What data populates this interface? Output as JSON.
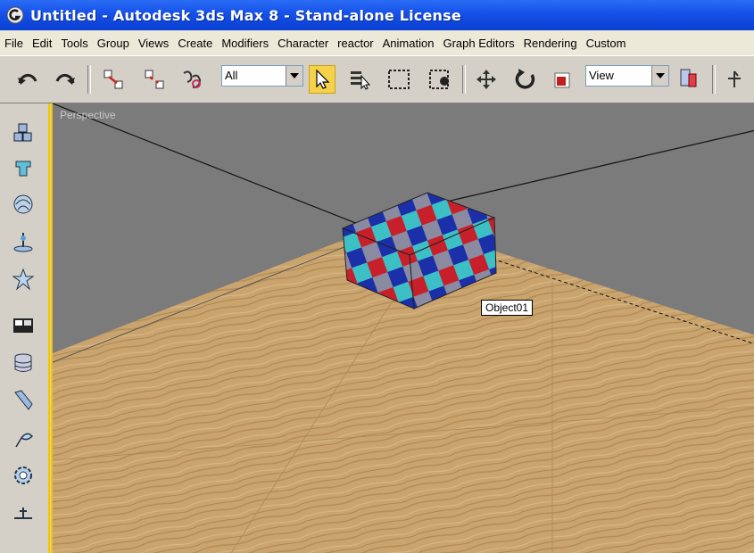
{
  "window": {
    "title": "Untitled - Autodesk 3ds Max 8  - Stand-alone License"
  },
  "menubar": {
    "items": [
      "File",
      "Edit",
      "Tools",
      "Group",
      "Views",
      "Create",
      "Modifiers",
      "Character",
      "reactor",
      "Animation",
      "Graph Editors",
      "Rendering",
      "Custom"
    ]
  },
  "toolbar": {
    "selection_filter": "All",
    "reference_coord": "View",
    "icons": [
      "undo-icon",
      "redo-icon",
      "select-and-link-icon",
      "unlink-selection-icon",
      "bind-to-space-warp-icon",
      "select-object-icon",
      "select-by-name-icon",
      "rectangular-selection-region-icon",
      "window-crossing-icon",
      "select-and-move-icon",
      "select-and-rotate-icon",
      "select-and-scale-icon",
      "use-pivot-center-icon",
      "select-and-manipulate-icon"
    ]
  },
  "command_panel": {
    "icons": [
      "create-icon",
      "modify-icon",
      "hierarchy-icon",
      "motion-icon",
      "display-icon",
      "utilities-icon",
      "layer-icon",
      "material-icon",
      "render-icon",
      "settings-icon",
      "pin-icon"
    ]
  },
  "viewport": {
    "label": "Perspective",
    "tooltip": "Object01",
    "background_color": "#7b7b7b",
    "floor_color": "#c9a46e"
  }
}
